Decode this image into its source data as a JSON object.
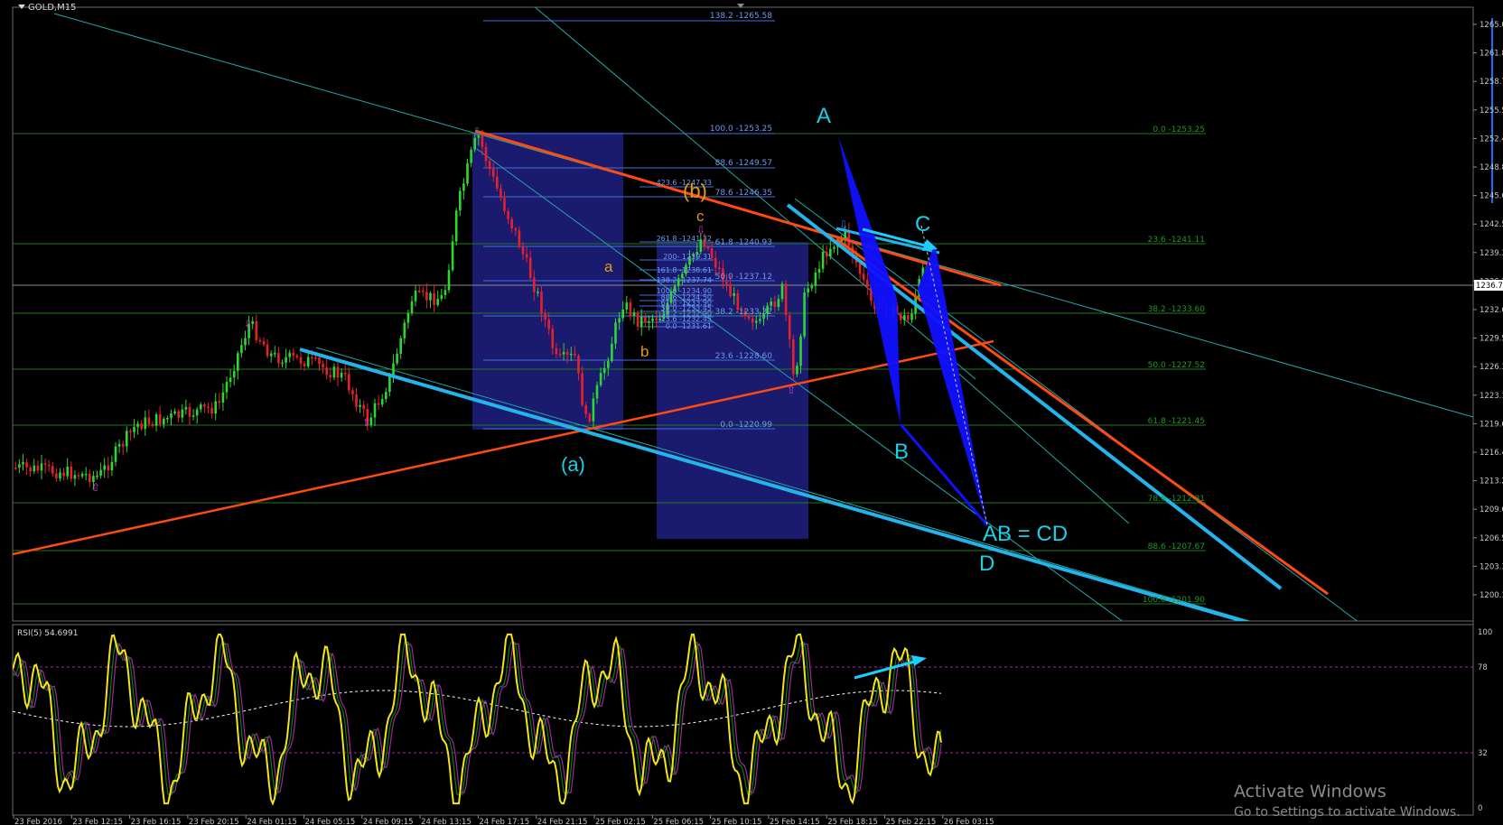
{
  "window": {
    "title": "GOLD,M15"
  },
  "colors": {
    "background": "#000000",
    "bull": "#2fd62f",
    "bear": "#e8202c",
    "trend_red": "#ff4a10",
    "channel_blue": "#24b4ec",
    "thin_cyan": "#22a8a8",
    "harmonic": "#1010ff",
    "fib_green": "#1e7a1e",
    "fib_blue": "#4f7fe0",
    "rsi": "#f2e614"
  },
  "price_axis": {
    "labels": [
      "1265.0",
      "1261.8",
      "1258.7",
      "1255.5",
      "1252.4",
      "1248.8",
      "1245.6",
      "1242.5",
      "1239.3",
      "1236.2",
      "1232.6",
      "1229.5",
      "1226.3",
      "1223.1",
      "1219.6",
      "1216.4",
      "1213.2",
      "1209.6",
      "1206.5",
      "1203.3",
      "1200.1"
    ],
    "current": "1236.7"
  },
  "time_axis": {
    "labels": [
      "23 Feb 2016",
      "23 Feb 12:15",
      "23 Feb 16:15",
      "23 Feb 20:15",
      "24 Feb 01:15",
      "24 Feb 05:15",
      "24 Feb 09:15",
      "24 Feb 13:15",
      "24 Feb 17:15",
      "24 Feb 21:15",
      "25 Feb 02:15",
      "25 Feb 06:15",
      "25 Feb 10:15",
      "25 Feb 14:15",
      "25 Feb 18:15",
      "25 Feb 22:15",
      "26 Feb 03:15"
    ]
  },
  "fib_right": [
    "0.0 -1253.25",
    "23.6 -1241.11",
    "38.2 -1233.60",
    "50.0 -1227.52",
    "61.8 -1221.45",
    "78.6 -1212.81",
    "88.6 -1207.67",
    "100.0 -1201.90"
  ],
  "fib_mid": [
    "138.2 -1265.58",
    "100.0 -1253.25",
    "88.6 -1249.57",
    "78.6 -1246.35",
    "61.8 -1240.93",
    "50.0 -1237.12",
    "38.2 -1233.32",
    "23.6 -1228.60",
    "0.0 -1220.99"
  ],
  "fib_ext": [
    "423.6 -1247.33",
    "261.8 -1241.32",
    "200- 1239.31",
    "161.8 -1238.61",
    "138.2 -1237.74",
    "100.0 -1234.90",
    "88.6 -1234.50",
    "61.8 -1233.90",
    "50.0 -1233.45",
    "38.2 -1232.90",
    "23.6 -1232.45",
    "0.0 -1231.61"
  ],
  "waves": {
    "A": "A",
    "B": "B",
    "C": "C",
    "D": "D",
    "ab_cd": "AB = CD",
    "a_paren": "(a)",
    "b_paren": "(b)",
    "a": "a",
    "b": "b",
    "c": "c"
  },
  "rsi": {
    "title": "RSI(5) 54.6991",
    "levels": [
      "100",
      "78",
      "32",
      "0"
    ]
  },
  "watermark": {
    "line1": "Activate Windows",
    "line2": "Go to Settings to activate Windows."
  }
}
